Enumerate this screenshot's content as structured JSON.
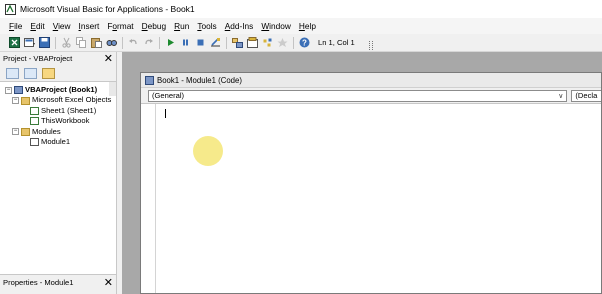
{
  "window": {
    "title": "Microsoft Visual Basic for Applications - Book1"
  },
  "menu": [
    {
      "label": "File",
      "accel": "F",
      "rest": "ile"
    },
    {
      "label": "Edit",
      "accel": "E",
      "rest": "dit"
    },
    {
      "label": "View",
      "accel": "V",
      "rest": "iew"
    },
    {
      "label": "Insert",
      "accel": "I",
      "rest": "nsert"
    },
    {
      "label": "Format",
      "accel": "o",
      "pre": "F",
      "rest": "rmat"
    },
    {
      "label": "Debug",
      "accel": "D",
      "rest": "ebug"
    },
    {
      "label": "Run",
      "accel": "R",
      "rest": "un"
    },
    {
      "label": "Tools",
      "accel": "T",
      "rest": "ools"
    },
    {
      "label": "Add-Ins",
      "accel": "A",
      "rest": "dd-Ins"
    },
    {
      "label": "Window",
      "accel": "W",
      "rest": "indow"
    },
    {
      "label": "Help",
      "accel": "H",
      "rest": "elp"
    }
  ],
  "toolbar": {
    "status": "Ln 1, Col 1"
  },
  "project_panel": {
    "title": "Project - VBAProject",
    "tree": {
      "root": "VBAProject (Book1)",
      "excel_objects": "Microsoft Excel Objects",
      "sheet1": "Sheet1 (Sheet1)",
      "thisworkbook": "ThisWorkbook",
      "modules": "Modules",
      "module1": "Module1"
    }
  },
  "properties_panel": {
    "title": "Properties - Module1"
  },
  "code_window": {
    "title": "Book1 - Module1 (Code)",
    "object_combo": "(General)",
    "proc_combo": "(Decla"
  },
  "colors": {
    "mdi_background": "#a8a8a8",
    "cursor_highlight": "#f6e985"
  }
}
